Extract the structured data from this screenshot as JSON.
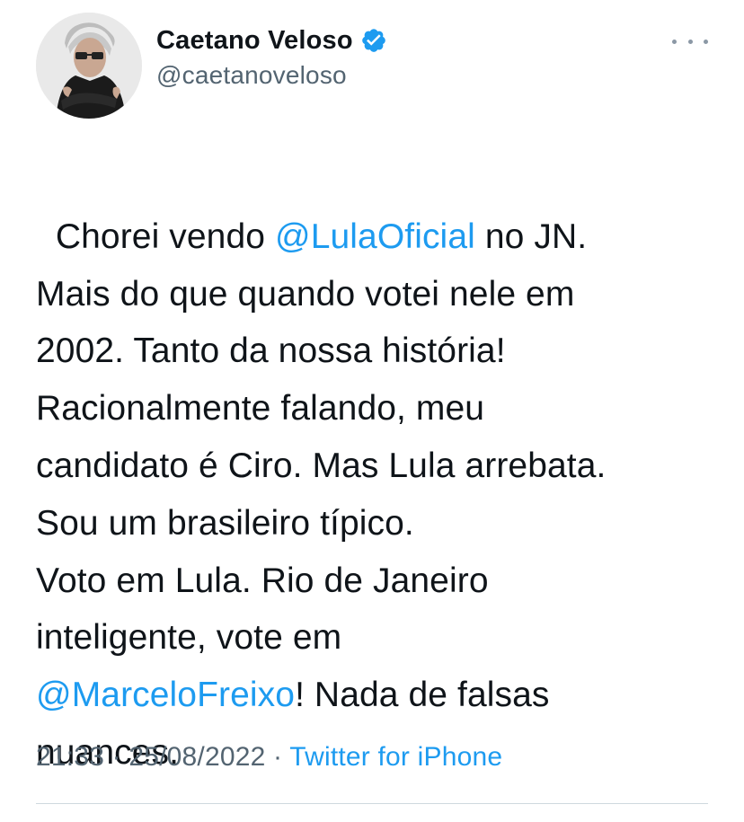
{
  "author": {
    "display_name": "Caetano Veloso",
    "handle": "@caetanoveloso",
    "verified": true
  },
  "tweet": {
    "segments": [
      {
        "text": "Chorei vendo ",
        "mention": false
      },
      {
        "text": "@LulaOficial",
        "mention": true
      },
      {
        "text": " no JN.\nMais do que quando votei nele em\n2002. Tanto da nossa história!\nRacionalmente falando, meu\ncandidato é Ciro. Mas Lula arrebata.\nSou um brasileiro típico.\nVoto em Lula. Rio de Janeiro\ninteligente, vote em\n",
        "mention": false
      },
      {
        "text": "@MarceloFreixo",
        "mention": true
      },
      {
        "text": "! Nada de falsas\nnuances.",
        "mention": false
      }
    ]
  },
  "meta": {
    "time": "21:33",
    "separator": " · ",
    "date": "25/08/2022",
    "source": "Twitter for iPhone"
  },
  "icons": {
    "verified": "verified-badge-icon",
    "more": "more-options-icon"
  },
  "colors": {
    "accent": "#1d9bf0",
    "text": "#0f1419",
    "muted": "#536471",
    "divider": "#cfd9de"
  }
}
